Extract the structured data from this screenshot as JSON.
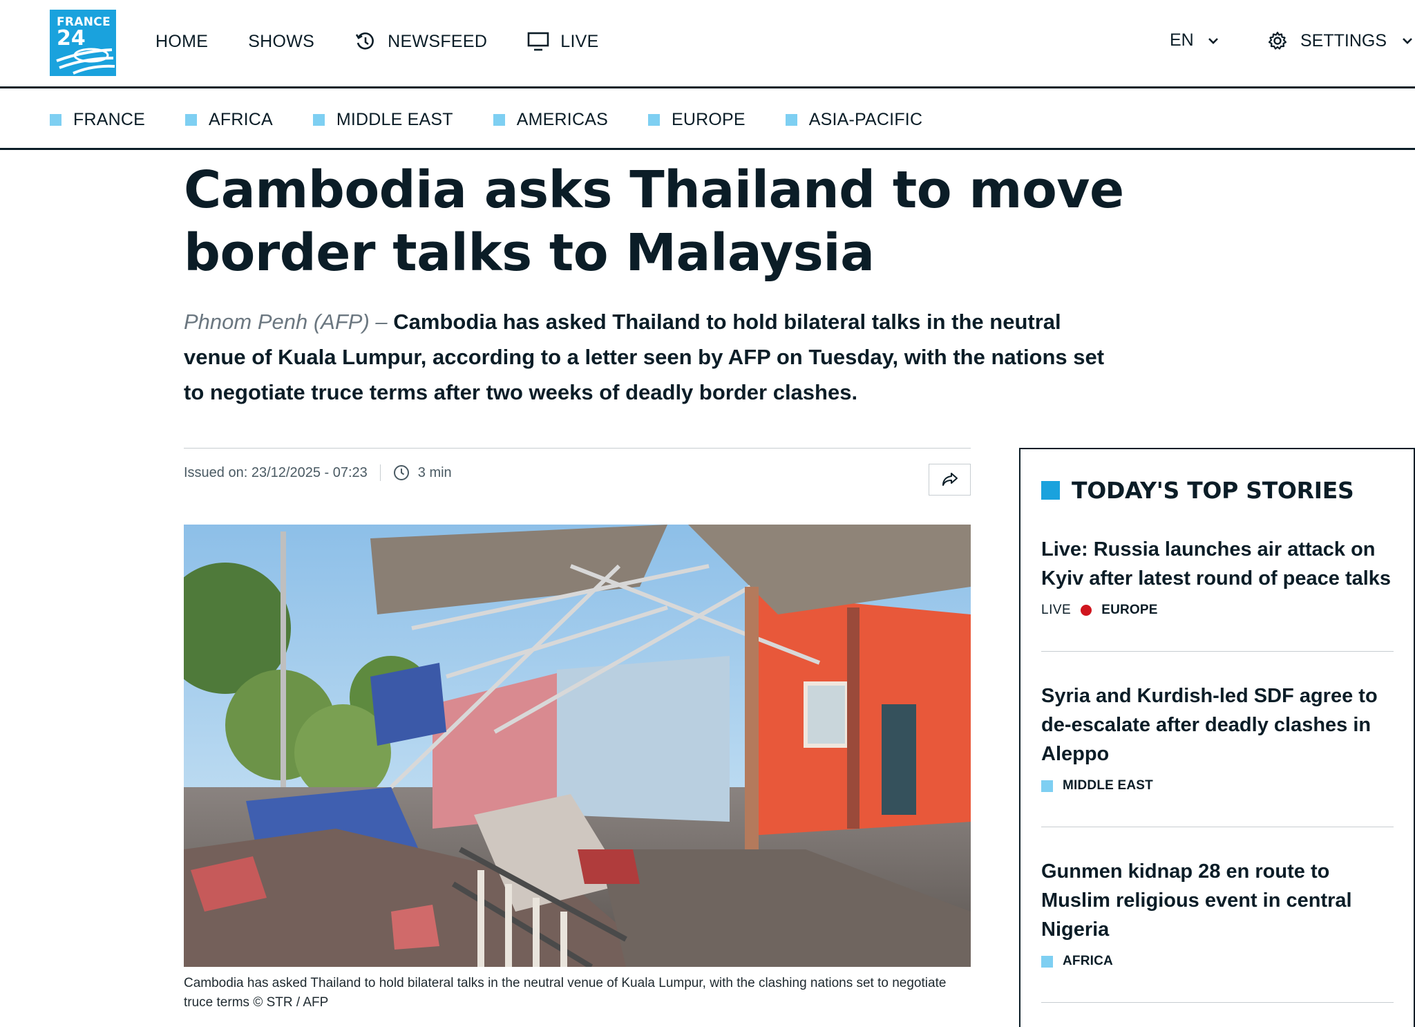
{
  "brand": {
    "line1": "FRANCE",
    "line2": "24",
    "color": "#1aa2dd"
  },
  "nav": {
    "items": [
      {
        "label": "HOME",
        "icon": ""
      },
      {
        "label": "SHOWS",
        "icon": ""
      },
      {
        "label": "NEWSFEED",
        "icon": "history-icon"
      },
      {
        "label": "LIVE",
        "icon": "monitor-icon"
      }
    ],
    "language": "EN",
    "settings": "SETTINGS"
  },
  "regions": [
    "FRANCE",
    "AFRICA",
    "MIDDLE EAST",
    "AMERICAS",
    "EUROPE",
    "ASIA-PACIFIC"
  ],
  "article": {
    "headline": "Cambodia asks Thailand to move border talks to Malaysia",
    "dateline": "Phnom Penh (AFP) –",
    "lede": "Cambodia has asked Thailand to hold bilateral talks in the neutral venue of Kuala Lumpur, according to a letter seen by AFP on Tuesday, with the nations set to negotiate truce terms after two weeks of deadly border clashes.",
    "issued": "Issued on: 23/12/2025 - 07:23",
    "read_time": "3 min",
    "caption": "Cambodia has asked Thailand to hold bilateral talks in the neutral venue of Kuala Lumpur, with the clashing nations set to negotiate truce terms",
    "credit": "© STR / AFP"
  },
  "sidebar": {
    "title": "TODAY'S TOP STORIES",
    "stories": [
      {
        "title": "Live: Russia launches air attack on Kyiv after latest round of peace talks",
        "live": "LIVE",
        "tag": "EUROPE"
      },
      {
        "title": "Syria and Kurdish-led SDF agree to de-escalate after deadly clashes in Aleppo",
        "tag": "MIDDLE EAST"
      },
      {
        "title": "Gunmen kidnap 28 en route to Muslim religious event in central Nigeria",
        "tag": "AFRICA"
      }
    ]
  },
  "colors": {
    "ink": "#0b1d27",
    "accent": "#1aa2dd",
    "region_square": "#7ecff2",
    "live_dot": "#d0151e"
  }
}
